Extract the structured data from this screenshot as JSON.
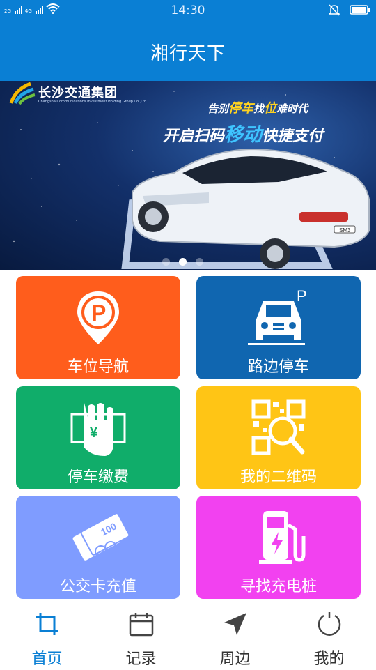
{
  "status_bar": {
    "time": "14:30",
    "sig1_label": "2G",
    "sig2_label": "4G",
    "icons": [
      "signal-icon",
      "signal-icon",
      "wifi-icon",
      "mute-icon",
      "battery-icon"
    ]
  },
  "header": {
    "title": "湘行天下"
  },
  "banner": {
    "logo_text": "长沙交通集团",
    "logo_subtext": "Changsha Communications Investment Holding Group Co.,Ltd.",
    "slogan1_a": "告别",
    "slogan1_b": "停车",
    "slogan1_c": "找",
    "slogan1_d": "位",
    "slogan1_e": "难时代",
    "slogan2_a": "开启扫码",
    "slogan2_b": "移动",
    "slogan2_c": "快捷支付",
    "plate": "SM3",
    "carousel_total": 3,
    "carousel_active": 2
  },
  "tiles": [
    {
      "label": "车位导航",
      "color": "#ff5d1c",
      "icon": "parking-pin-icon"
    },
    {
      "label": "路边停车",
      "color": "#1066b0",
      "icon": "car-parking-icon"
    },
    {
      "label": "停车缴费",
      "color": "#10ad6a",
      "icon": "hand-payment-icon"
    },
    {
      "label": "我的二维码",
      "color": "#ffc515",
      "icon": "qr-scan-icon"
    },
    {
      "label": "公交卡充值",
      "color": "#7f9cff",
      "icon": "bus-card-icon"
    },
    {
      "label": "寻找充电桩",
      "color": "#f241f0",
      "icon": "charging-station-icon"
    }
  ],
  "tabs": [
    {
      "label": "首页",
      "icon": "crop-icon",
      "active": true
    },
    {
      "label": "记录",
      "icon": "calendar-icon",
      "active": false
    },
    {
      "label": "周边",
      "icon": "navigation-arrow-icon",
      "active": false
    },
    {
      "label": "我的",
      "icon": "power-icon",
      "active": false
    }
  ],
  "colors": {
    "accent": "#0a7fd4",
    "tab_active": "#0a7fd4",
    "tab_inactive": "#333333"
  }
}
